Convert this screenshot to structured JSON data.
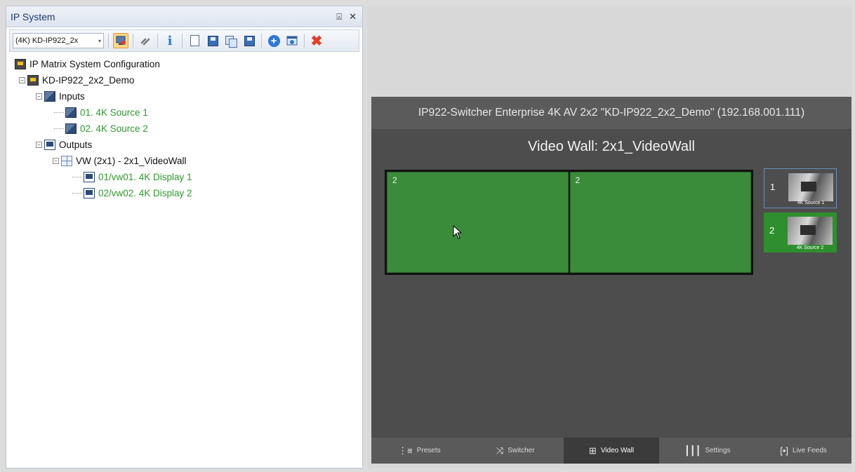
{
  "panel": {
    "title": "IP System",
    "pin_glyph": "⍓",
    "close_glyph": "✕"
  },
  "toolbar": {
    "combo_value": "(4K) KD-IP922_2x",
    "combo_arrow": "▾"
  },
  "tree": {
    "root": "IP Matrix System Configuration",
    "system": "KD-IP922_2x2_Demo",
    "inputs": "Inputs",
    "input_1": "01. 4K Source 1",
    "input_2": "02. 4K Source 2",
    "outputs": "Outputs",
    "videowall": "VW (2x1) - 2x1_VideoWall",
    "display_1": "01/vw01. 4K Display 1",
    "display_2": "02/vw02. 4K Display 2"
  },
  "app": {
    "title": "IP922-Switcher Enterprise 4K AV 2x2 \"KD-IP922_2x2_Demo\" (192.168.001.111)",
    "videowall_title": "Video Wall: 2x1_VideoWall",
    "cells": [
      "2",
      "2"
    ],
    "sources": [
      {
        "number": "1",
        "caption": "4K Source 1"
      },
      {
        "number": "2",
        "caption": "4K Source 2"
      }
    ],
    "tabs": [
      {
        "icon": "⋮≡",
        "label": "Presets"
      },
      {
        "icon": "⤨",
        "label": "Switcher"
      },
      {
        "icon": "⊞",
        "label": "Video Wall"
      },
      {
        "icon": "┃┃┃",
        "label": "Settings"
      },
      {
        "icon": "[•]",
        "label": "Live Feeds"
      }
    ]
  },
  "colors": {
    "accent_green": "#3a8b3a",
    "tree_green": "#2e9b2e",
    "panel_title": "#1e3a6e"
  }
}
